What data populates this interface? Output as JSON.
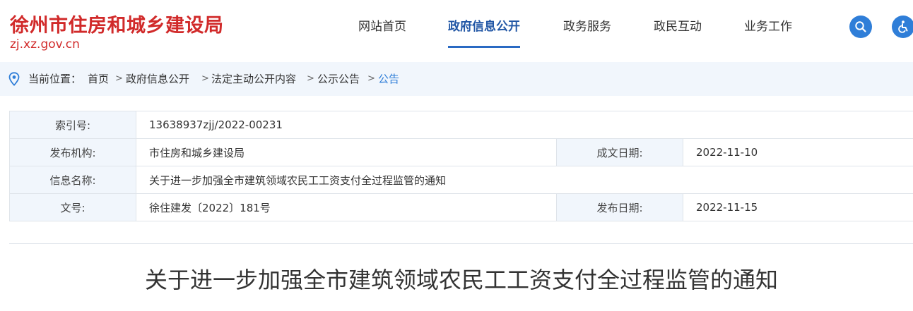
{
  "header": {
    "site_title": "徐州市住房和城乡建设局",
    "site_domain": "zj.xz.gov.cn",
    "nav": [
      "网站首页",
      "政府信息公开",
      "政务服务",
      "政民互动",
      "业务工作"
    ],
    "active_nav_index": 1,
    "icons": [
      "search-icon",
      "accessibility-icon"
    ]
  },
  "breadcrumb": {
    "label": "当前位置：",
    "items": [
      "首页",
      "政府信息公开",
      "法定主动公开内容",
      "公示公告",
      "公告"
    ],
    "separator": ">"
  },
  "info": {
    "index_label": "索引号:",
    "index_value": "13638937zjj/2022-00231",
    "publisher_label": "发布机构:",
    "publisher_value": "市住房和城乡建设局",
    "created_label": "成文日期:",
    "created_value": "2022-11-10",
    "name_label": "信息名称:",
    "name_value": "关于进一步加强全市建筑领域农民工工资支付全过程监管的通知",
    "docno_label": "文号:",
    "docno_value": "徐住建发〔2022〕181号",
    "published_label": "发布日期:",
    "published_value": "2022-11-15"
  },
  "document": {
    "title": "关于进一步加强全市建筑领域农民工工资支付全过程监管的通知"
  },
  "colors": {
    "brand_red": "#d12a2a",
    "accent_blue": "#2f7ed8",
    "active_nav": "#2156a5",
    "label_bg": "#f1f6fc"
  }
}
